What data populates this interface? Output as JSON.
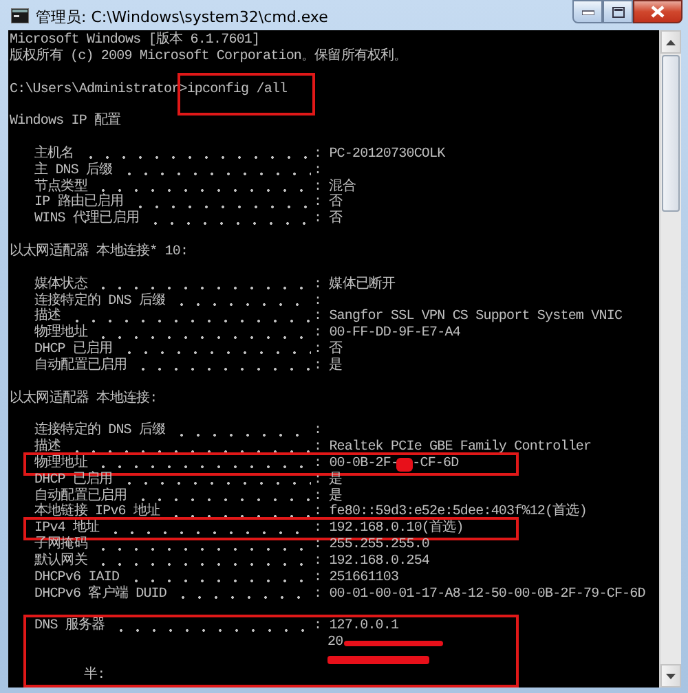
{
  "window": {
    "title": "管理员: C:\\Windows\\system32\\cmd.exe"
  },
  "console": {
    "lines": [
      {
        "kind": "text",
        "text": "Microsoft Windows [版本 6.1.7601]"
      },
      {
        "kind": "text",
        "text": "版权所有 (c) 2009 Microsoft Corporation。保留所有权利。"
      },
      {
        "kind": "blank"
      },
      {
        "kind": "command",
        "prompt": "C:\\Users\\Administrator>",
        "command": "ipconfig /all",
        "highlighted": true
      },
      {
        "kind": "blank"
      },
      {
        "kind": "text",
        "text": "Windows IP 配置"
      },
      {
        "kind": "blank"
      },
      {
        "kind": "entry",
        "label": "主机名",
        "value": ": PC-20120730COLK"
      },
      {
        "kind": "entry",
        "label": "主 DNS 后缀",
        "value": ":"
      },
      {
        "kind": "entry",
        "label": "节点类型",
        "value": ": 混合"
      },
      {
        "kind": "entry",
        "label": "IP 路由已启用",
        "value": ": 否"
      },
      {
        "kind": "entry",
        "label": "WINS 代理已启用",
        "value": ": 否"
      },
      {
        "kind": "blank"
      },
      {
        "kind": "text",
        "text": "以太网适配器 本地连接* 10:"
      },
      {
        "kind": "blank"
      },
      {
        "kind": "entry",
        "label": "媒体状态",
        "value": ": 媒体已断开"
      },
      {
        "kind": "entry",
        "label": "连接特定的 DNS 后缀",
        "value": ":"
      },
      {
        "kind": "entry",
        "label": "描述",
        "value": ": Sangfor SSL VPN CS Support System VNIC"
      },
      {
        "kind": "entry",
        "label": "物理地址",
        "value": ": 00-FF-DD-9F-E7-A4"
      },
      {
        "kind": "entry",
        "label": "DHCP 已启用",
        "value": ": 否"
      },
      {
        "kind": "entry",
        "label": "自动配置已启用",
        "value": ": 是"
      },
      {
        "kind": "blank"
      },
      {
        "kind": "text",
        "text": "以太网适配器 本地连接:"
      },
      {
        "kind": "blank"
      },
      {
        "kind": "entry",
        "label": "连接特定的 DNS 后缀",
        "value": ":"
      },
      {
        "kind": "entry",
        "label": "描述",
        "value": ": Realtek PCIe GBE Family Controller"
      },
      {
        "kind": "boxed_group",
        "lines": [
          {
            "kind": "entry",
            "label": "物理地址",
            "value": ": 00-0B-2F-",
            "redacted": true,
            "value_tail": "-CF-6D"
          }
        ]
      },
      {
        "kind": "entry",
        "label": "DHCP 已启用",
        "value": ": 是"
      },
      {
        "kind": "entry",
        "label": "自动配置已启用",
        "value": ": 是"
      },
      {
        "kind": "entry",
        "label": "本地链接 IPv6 地址",
        "value": ": fe80::59d3:e52e:5dee:403f%12(首选)"
      },
      {
        "kind": "boxed_group",
        "lines": [
          {
            "kind": "entry",
            "label": "IPv4 地址",
            "value": ": 192.168.0.10(首选)"
          }
        ]
      },
      {
        "kind": "entry",
        "label": "子网掩码",
        "value": ": 255.255.255.0"
      },
      {
        "kind": "entry",
        "label": "默认网关",
        "value": ": 192.168.0.254"
      },
      {
        "kind": "entry",
        "label": "DHCPv6 IAID",
        "value": ": 251661103"
      },
      {
        "kind": "entry",
        "label": "DHCPv6 客户端 DUID",
        "value": ": 00-01-00-01-17-A8-12-50-00-0B-2F-79-CF-6D"
      },
      {
        "kind": "blank"
      },
      {
        "kind": "boxed_group",
        "lines": [
          {
            "kind": "entry",
            "label": "DNS 服务器",
            "value": ": 127.0.0.1"
          },
          {
            "kind": "continuation",
            "value": "20",
            "redacted": true
          },
          {
            "kind": "continuation",
            "redacted": true
          },
          {
            "kind": "fragment",
            "text": "半:"
          }
        ]
      }
    ]
  }
}
